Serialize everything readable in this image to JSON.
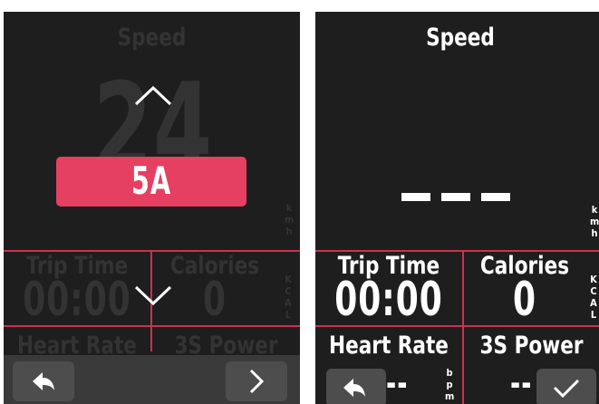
{
  "left_screen": {
    "title": "Speed",
    "speed_value": "24",
    "speed_unit": [
      "k",
      "m",
      "h"
    ],
    "up_arrow_icon": "chevron-up-icon",
    "down_arrow_icon": "chevron-down-icon",
    "selected_value": "5A",
    "trip_time_label": "Trip Time",
    "trip_time_value": "00:00",
    "calories_label": "Calories",
    "calories_value": "0",
    "calories_unit": [
      "K",
      "C",
      "A",
      "L"
    ],
    "heart_rate_label": "Heart Rate",
    "power_label": "3S Power",
    "back_icon": "back-arrow-icon",
    "next_icon": "chevron-right-icon"
  },
  "right_screen": {
    "title": "Speed",
    "speed_value": "---",
    "speed_unit": [
      "k",
      "m",
      "h"
    ],
    "trip_time_label": "Trip Time",
    "trip_time_value": "00:00",
    "calories_label": "Calories",
    "calories_value": "0",
    "calories_unit": [
      "K",
      "C",
      "A",
      "L"
    ],
    "heart_rate_label": "Heart Rate",
    "heart_rate_value": "--",
    "heart_rate_unit": [
      "b",
      "p",
      "m"
    ],
    "power_label": "3S Power",
    "power_value": "--",
    "power_unit": [
      "w"
    ],
    "back_icon": "back-arrow-icon",
    "confirm_icon": "checkmark-icon"
  },
  "colors": {
    "background": "#1e1e1e",
    "accent": "#e54062",
    "divider": "#c9334f",
    "dim_text": "#333333",
    "text": "#ffffff",
    "button": "#4d4d4d"
  }
}
